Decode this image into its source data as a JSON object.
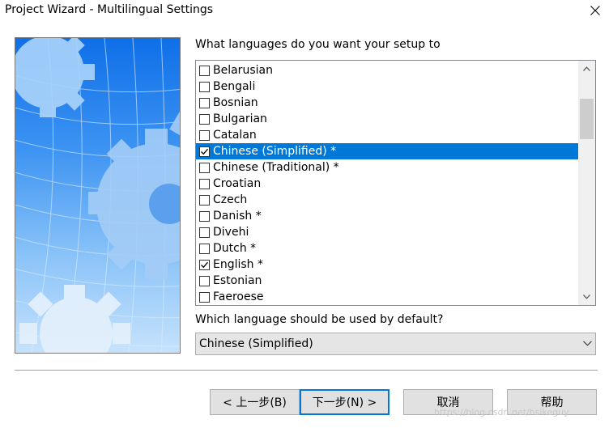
{
  "window": {
    "title": "Project Wizard - Multilingual Settings",
    "close_label": "close"
  },
  "languages": {
    "prompt": "What languages do you want your setup to",
    "items": [
      {
        "label": "Belarusian",
        "checked": false,
        "selected": false
      },
      {
        "label": "Bengali",
        "checked": false,
        "selected": false
      },
      {
        "label": "Bosnian",
        "checked": false,
        "selected": false
      },
      {
        "label": "Bulgarian",
        "checked": false,
        "selected": false
      },
      {
        "label": "Catalan",
        "checked": false,
        "selected": false
      },
      {
        "label": "Chinese (Simplified) *",
        "checked": true,
        "selected": true
      },
      {
        "label": "Chinese (Traditional) *",
        "checked": false,
        "selected": false
      },
      {
        "label": "Croatian",
        "checked": false,
        "selected": false
      },
      {
        "label": "Czech",
        "checked": false,
        "selected": false
      },
      {
        "label": "Danish *",
        "checked": false,
        "selected": false
      },
      {
        "label": "Divehi",
        "checked": false,
        "selected": false
      },
      {
        "label": "Dutch *",
        "checked": false,
        "selected": false
      },
      {
        "label": "English *",
        "checked": true,
        "selected": false
      },
      {
        "label": "Estonian",
        "checked": false,
        "selected": false
      },
      {
        "label": "Faeroese",
        "checked": false,
        "selected": false
      }
    ]
  },
  "default_language": {
    "prompt": "Which language should be used by default?",
    "value": "Chinese (Simplified)"
  },
  "buttons": {
    "back": "< 上一步(B)",
    "next": "下一步(N) >",
    "cancel": "取消",
    "help": "帮助"
  },
  "watermark": "https://blog.csdn.net/hsikeguy",
  "colors": {
    "selection": "#0078d7",
    "button_face": "#e1e1e1",
    "default_border": "#0078d7"
  }
}
